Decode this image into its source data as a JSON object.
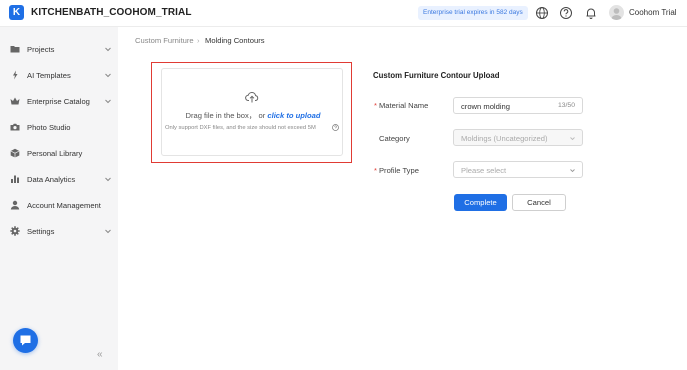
{
  "app": {
    "logo_letter": "K",
    "title": "KITCHENBATH_COOHOM_TRIAL",
    "trial_badge": "Enterprise trial expires in 582 days",
    "user_name": "Coohom Trial",
    "brand_color": "#1f6fe5"
  },
  "sidebar": {
    "items": [
      {
        "label": "Projects",
        "icon": "folder-icon",
        "has_chevron": true
      },
      {
        "label": "AI Templates",
        "icon": "sparkle-icon",
        "has_chevron": true
      },
      {
        "label": "Enterprise Catalog",
        "icon": "crown-icon",
        "has_chevron": true
      },
      {
        "label": "Photo Studio",
        "icon": "camera-icon",
        "has_chevron": false
      },
      {
        "label": "Personal Library",
        "icon": "box-icon",
        "has_chevron": false
      },
      {
        "label": "Data Analytics",
        "icon": "bar-chart-icon",
        "has_chevron": true
      },
      {
        "label": "Account Management",
        "icon": "user-icon",
        "has_chevron": false
      },
      {
        "label": "Settings",
        "icon": "gear-icon",
        "has_chevron": true
      }
    ],
    "collapse_glyph": "«"
  },
  "breadcrumb": {
    "parent": "Custom Furniture",
    "separator": "›",
    "current": "Molding Contours"
  },
  "upload": {
    "drag_text": "Drag file in the box， or ",
    "link_text": "click to upload",
    "hint": "Only support DXF files, and the size should not exceed 5M"
  },
  "form": {
    "title": "Custom Furniture Contour Upload",
    "material_name": {
      "label": "Material Name",
      "value": "crown molding",
      "count": "13/50",
      "required": "*"
    },
    "category": {
      "label": "Category",
      "value": "Moldings (Uncategorized)"
    },
    "profile_type": {
      "label": "Profile Type",
      "placeholder": "Please select",
      "required": "*"
    },
    "complete_label": "Complete",
    "cancel_label": "Cancel"
  }
}
